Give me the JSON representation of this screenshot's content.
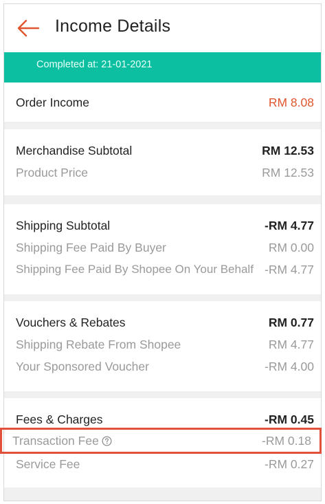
{
  "header": {
    "title": "Income Details",
    "back_icon": "back-arrow-icon"
  },
  "banner": {
    "completed": "Completed at: 21-01-2021"
  },
  "order_income": {
    "label": "Order Income",
    "value": "RM 8.08"
  },
  "merchandise": {
    "title": "Merchandise Subtotal",
    "total": "RM 12.53",
    "items": [
      {
        "label": "Product Price",
        "value": "RM 12.53"
      }
    ]
  },
  "shipping": {
    "title": "Shipping Subtotal",
    "total": "-RM 4.77",
    "items": [
      {
        "label": "Shipping Fee Paid By Buyer",
        "value": "RM 0.00"
      },
      {
        "label": "Shipping Fee Paid By Shopee On Your Behalf",
        "value": "-RM 4.77"
      }
    ]
  },
  "vouchers": {
    "title": "Vouchers & Rebates",
    "total": "RM 0.77",
    "items": [
      {
        "label": "Shipping Rebate From Shopee",
        "value": "RM 4.77"
      },
      {
        "label": "Your Sponsored Voucher",
        "value": "-RM 4.00"
      }
    ]
  },
  "fees": {
    "title": "Fees & Charges",
    "total": "-RM 0.45",
    "items": [
      {
        "label": "Transaction Fee",
        "value": "-RM 0.18",
        "icon": "help-icon"
      },
      {
        "label": "Service Fee",
        "value": "-RM 0.27"
      }
    ]
  },
  "colors": {
    "accent": "#e0552d",
    "banner": "#0bbfa0",
    "highlight": "#e0503a"
  }
}
